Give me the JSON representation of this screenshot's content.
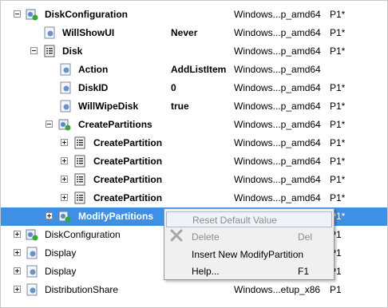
{
  "tree": {
    "rows": [
      {
        "name": "DiskConfiguration",
        "bold": true,
        "value": "",
        "arch": "Windows...p_amd64",
        "pass": "P1*",
        "icon": "settings-component-icon"
      },
      {
        "name": "WillShowUI",
        "bold": true,
        "value": "Never",
        "arch": "Windows...p_amd64",
        "pass": "P1*",
        "icon": "setting-icon"
      },
      {
        "name": "Disk",
        "bold": true,
        "value": "",
        "arch": "Windows...p_amd64",
        "pass": "P1*",
        "icon": "list-icon"
      },
      {
        "name": "Action",
        "bold": true,
        "value": "AddListItem",
        "arch": "Windows...p_amd64",
        "pass": "",
        "icon": "setting-icon"
      },
      {
        "name": "DiskID",
        "bold": true,
        "value": "0",
        "arch": "Windows...p_amd64",
        "pass": "P1*",
        "icon": "setting-icon"
      },
      {
        "name": "WillWipeDisk",
        "bold": true,
        "value": "true",
        "arch": "Windows...p_amd64",
        "pass": "P1*",
        "icon": "setting-icon"
      },
      {
        "name": "CreatePartitions",
        "bold": true,
        "value": "",
        "arch": "Windows...p_amd64",
        "pass": "P1*",
        "icon": "settings-component-icon"
      },
      {
        "name": "CreatePartition",
        "bold": true,
        "value": "",
        "arch": "Windows...p_amd64",
        "pass": "P1*",
        "icon": "list-icon"
      },
      {
        "name": "CreatePartition",
        "bold": true,
        "value": "",
        "arch": "Windows...p_amd64",
        "pass": "P1*",
        "icon": "list-icon"
      },
      {
        "name": "CreatePartition",
        "bold": true,
        "value": "",
        "arch": "Windows...p_amd64",
        "pass": "P1*",
        "icon": "list-icon"
      },
      {
        "name": "CreatePartition",
        "bold": true,
        "value": "",
        "arch": "Windows...p_amd64",
        "pass": "P1*",
        "icon": "list-icon"
      },
      {
        "name": "ModifyPartitions",
        "bold": true,
        "value": "",
        "arch": "",
        "pass": "P1*",
        "icon": "settings-component-icon"
      },
      {
        "name": "DiskConfiguration",
        "bold": false,
        "value": "",
        "arch": "",
        "pass": "P1",
        "icon": "settings-component-icon"
      },
      {
        "name": "Display",
        "bold": false,
        "value": "",
        "arch": "",
        "pass": "P1",
        "icon": "setting-icon"
      },
      {
        "name": "Display",
        "bold": false,
        "value": "",
        "arch": "",
        "pass": "P1",
        "icon": "setting-icon"
      },
      {
        "name": "DistributionShare",
        "bold": false,
        "value": "",
        "arch": "Windows...etup_x86",
        "pass": "P1",
        "icon": "setting-icon"
      }
    ]
  },
  "context_menu": {
    "items": [
      {
        "label": "Reset Default Value",
        "shortcut": "",
        "disabled": true
      },
      {
        "label": "Delete",
        "shortcut": "Del",
        "disabled": true,
        "icon": "delete-x-icon"
      },
      {
        "label": "Insert New ModifyPartition",
        "shortcut": "",
        "disabled": false
      },
      {
        "label": "Help...",
        "shortcut": "F1",
        "disabled": false
      }
    ]
  },
  "colors": {
    "selection": "#3f8fe4",
    "menu_background": "#f0f0f0",
    "disabled_text": "#8c8c8c"
  }
}
